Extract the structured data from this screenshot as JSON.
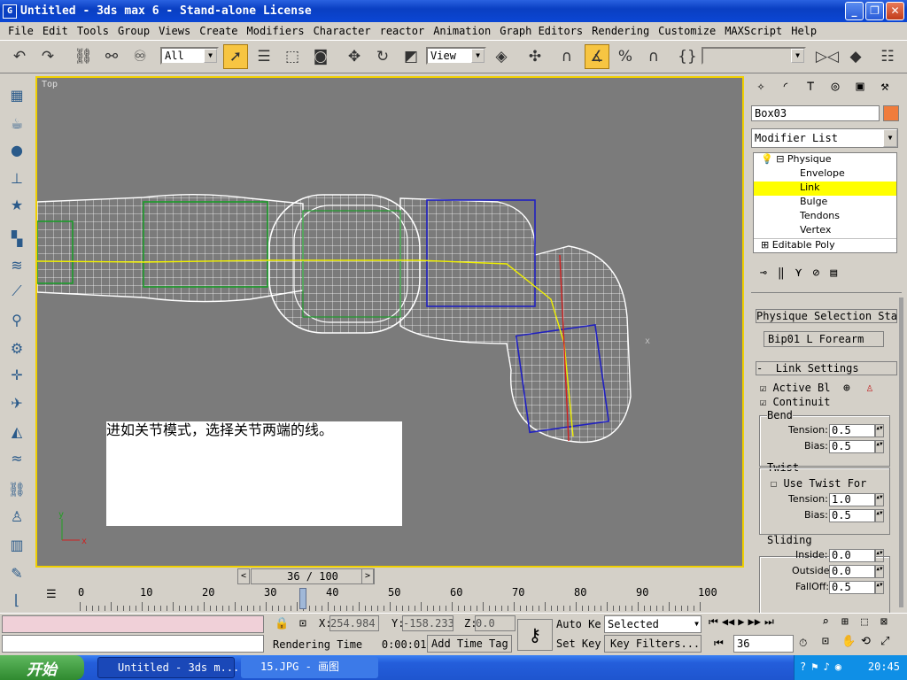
{
  "window": {
    "title": "Untitled - 3ds max 6 - Stand-alone License",
    "app_icon": "G"
  },
  "menu": [
    "File",
    "Edit",
    "Tools",
    "Group",
    "Views",
    "Create",
    "Modifiers",
    "Character",
    "reactor",
    "Animation",
    "Graph Editors",
    "Rendering",
    "Customize",
    "MAXScript",
    "Help"
  ],
  "toolbar": {
    "selection_filter": "All",
    "ref_coord": "View"
  },
  "viewport": {
    "label": "Top",
    "axis_x": "x",
    "axis_y": "y"
  },
  "note": {
    "text": "进如关节模式，选择关节两端的线。"
  },
  "timeline": {
    "frame_display": "36 / 100",
    "prev": "<",
    "next": ">",
    "ticks": [
      "0",
      "10",
      "20",
      "30",
      "40",
      "50",
      "60",
      "70",
      "80",
      "90",
      "100"
    ]
  },
  "command_panel": {
    "object_name": "Box03",
    "object_color": "#f07c3c",
    "modifier_list": "Modifier List",
    "stack": {
      "physique": "Physique",
      "items": [
        "Envelope",
        "Link",
        "Bulge",
        "Tendons",
        "Vertex"
      ],
      "selected": "Link",
      "editable_poly": "Editable Poly"
    },
    "selection_status_title": "Physique Selection Status",
    "selection_status_value": "Bip01 L Forearm",
    "link_settings_title": "Link Settings",
    "active_label": "Active Blending",
    "continuity_label": "Continuity",
    "bend": {
      "title": "Bend",
      "tension_label": "Tension:",
      "tension": "0.5",
      "bias_label": "Bias:",
      "bias": "0.5"
    },
    "twist": {
      "title": "Twist",
      "use_twist_label": "Use Twist For",
      "tension_label": "Tension:",
      "tension": "1.0",
      "bias_label": "Bias:",
      "bias": "0.5"
    },
    "sliding": {
      "title": "Sliding",
      "inside_label": "Inside:",
      "inside": "0.0",
      "outside_label": "Outside:",
      "outside": "0.0",
      "falloff_label": "FallOff:",
      "falloff": "0.5"
    }
  },
  "status": {
    "x_label": "X:",
    "x": "254.984",
    "y_label": "Y:",
    "y": "-158.233",
    "z_label": "Z:",
    "z": "0.0",
    "rendering_time_label": "Rendering Time",
    "rendering_time": "0:00:01",
    "add_time_tag": "Add Time Tag",
    "auto_key": "Auto Key",
    "set_key": "Set Key",
    "key_mode": "Selected",
    "key_filters": "Key Filters...",
    "frame": "36"
  },
  "taskbar": {
    "start": "开始",
    "tasks": [
      "Untitled - 3ds m...",
      "15.JPG - 画图"
    ],
    "clock": "20:45"
  }
}
